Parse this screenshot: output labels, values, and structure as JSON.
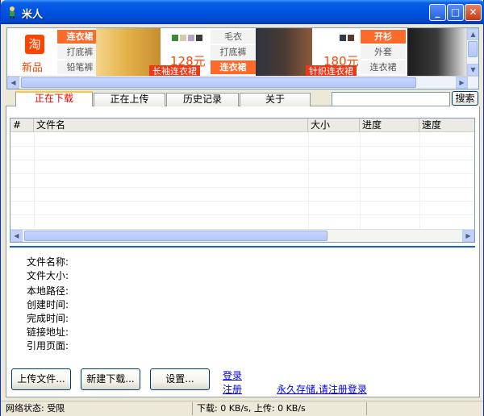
{
  "window": {
    "title": "米人",
    "minimize": "_",
    "maximize": "□",
    "close": "✕"
  },
  "ad": {
    "logo_glyph": "淘",
    "logo_text": "新品",
    "group1": [
      "连衣裙",
      "打底裤",
      "铅笔裤"
    ],
    "group2": [
      "毛衣",
      "打底裤",
      "连衣裙"
    ],
    "group3": [
      "开衫",
      "外套",
      "连衣裙"
    ],
    "price1": "128元",
    "price2": "180元",
    "banner1": "长袖连衣裙",
    "banner2": "针织连衣裙",
    "colors": {
      "brand": "#FF4400",
      "hot": "#FF6A2A"
    }
  },
  "tabs": [
    {
      "label": "正在下载",
      "active": true
    },
    {
      "label": "正在上传",
      "active": false
    },
    {
      "label": "历史记录",
      "active": false
    },
    {
      "label": "关于",
      "active": false
    }
  ],
  "search": {
    "value": "",
    "button": "搜索"
  },
  "list": {
    "columns": [
      "#",
      "文件名",
      "大小",
      "进度",
      "速度"
    ],
    "rows": []
  },
  "details": {
    "labels": [
      "文件名称:",
      "文件大小:",
      "本地路径:",
      "创建时间:",
      "完成时间:",
      "链接地址:",
      "引用页面:"
    ]
  },
  "buttons": {
    "upload": "上传文件...",
    "new_download": "新建下载...",
    "settings": "设置..."
  },
  "links": {
    "login": "登录",
    "register": "注册",
    "promo": "永久存储,请注册登录"
  },
  "status": {
    "network": "网络状态: 受限",
    "speed": "下载: 0 KB/s, 上传: 0 KB/s"
  },
  "icons": [
    "app-icon",
    "minimize-icon",
    "maximize-icon",
    "close-icon",
    "scroll-up-icon",
    "scroll-down-icon",
    "scroll-left-icon",
    "scroll-right-icon"
  ]
}
